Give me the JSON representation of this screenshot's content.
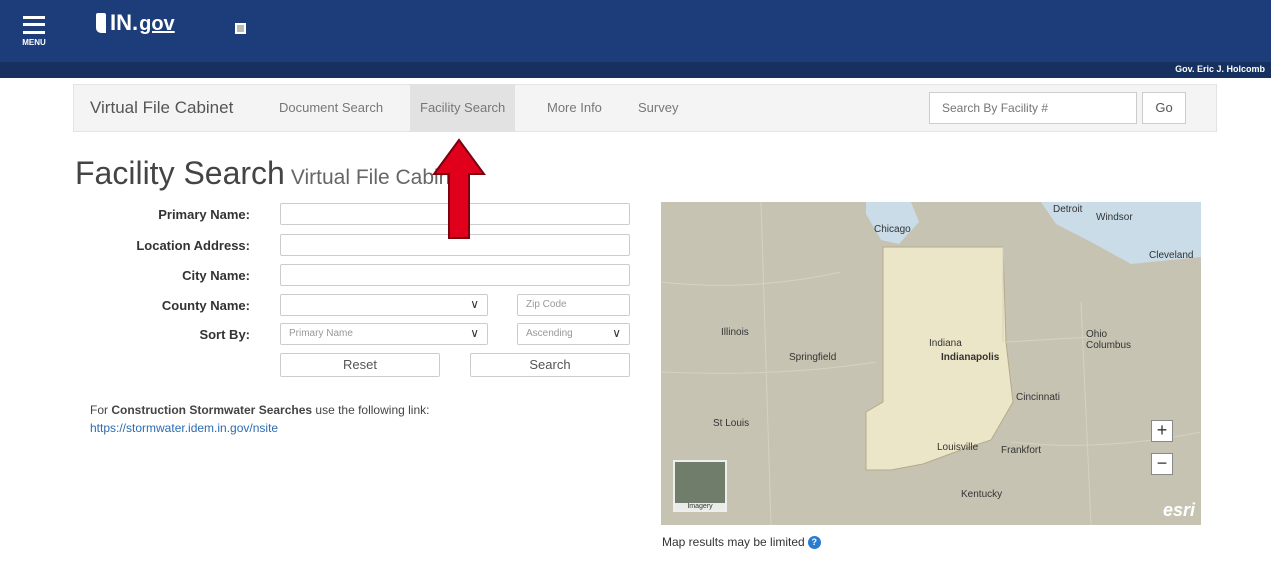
{
  "header": {
    "menu_label": "MENU",
    "logo_text": "IN",
    "logo_dot": ".",
    "logo_gov": "gov",
    "governor": "Gov. Eric J. Holcomb",
    "brand_color": "#1d3d7a"
  },
  "navbar": {
    "brand": "Virtual File Cabinet",
    "items": [
      {
        "label": "Document Search",
        "active": false
      },
      {
        "label": "Facility Search",
        "active": true
      },
      {
        "label": "More Info",
        "active": false
      },
      {
        "label": "Survey",
        "active": false
      }
    ],
    "search_placeholder": "Search By Facility #",
    "go_label": "Go"
  },
  "page": {
    "title": "Facility Search",
    "subtitle": "Virtual File Cabinet"
  },
  "form": {
    "primary_name_label": "Primary Name:",
    "location_address_label": "Location Address:",
    "city_name_label": "City Name:",
    "county_name_label": "County Name:",
    "sort_by_label": "Sort By:",
    "zip_placeholder": "Zip Code",
    "sort_by_value": "Primary Name",
    "sort_order_value": "Ascending",
    "reset_label": "Reset",
    "search_label": "Search"
  },
  "stormwater": {
    "prefix": "For ",
    "bold": "Construction Stormwater Searches",
    "suffix": " use the following link:",
    "link": "https://stormwater.idem.in.gov/nsite"
  },
  "map": {
    "labels": {
      "chicago": "Chicago",
      "detroit": "Detroit",
      "windsor": "Windsor",
      "cleveland": "Cleveland",
      "illinois": "Illinois",
      "springfield": "Springfield",
      "indiana": "Indiana",
      "indianapolis": "Indianapolis",
      "ohio": "Ohio",
      "columbus": "Columbus",
      "cincinnati": "Cincinnati",
      "st_louis": "St Louis",
      "louisville": "Louisville",
      "frankfort": "Frankfort",
      "kentucky": "Kentucky"
    },
    "zoom_in": "+",
    "zoom_out": "−",
    "basemap_label": "Imagery",
    "attribution": "esri",
    "note": "Map results may be limited"
  }
}
